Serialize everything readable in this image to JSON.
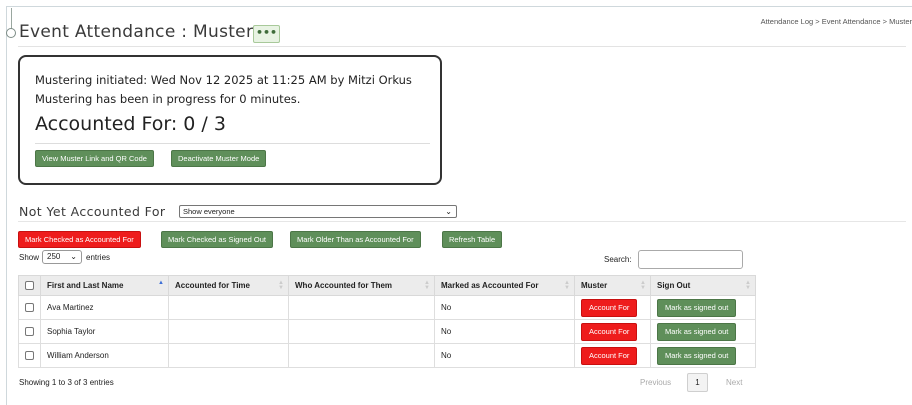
{
  "header": {
    "title": "Event Attendance : Muster",
    "more_label": "•••",
    "breadcrumb": "Attendance Log > Event Attendance > Muster"
  },
  "muster": {
    "initiated_text": "Mustering initiated: Wed Nov 12 2025 at 11:25 AM by Mitzi Orkus",
    "progress_text": "Mustering has been in progress for 0 minutes.",
    "accounted_text": "Accounted For: 0 / 3",
    "view_link_label": "View Muster Link and QR Code",
    "deactivate_label": "Deactivate Muster Mode"
  },
  "section": {
    "title": "Not Yet Accounted For",
    "filter_selected": "Show everyone"
  },
  "actions": {
    "mark_checked_accounted": "Mark Checked as Accounted For",
    "mark_checked_signed_out": "Mark Checked as Signed Out",
    "mark_older_than": "Mark Older Than as Accounted For",
    "refresh": "Refresh Table"
  },
  "table_controls": {
    "show_label": "Show",
    "page_size": "250",
    "entries_label": "entries",
    "search_label": "Search:"
  },
  "table": {
    "columns": [
      "First and Last Name",
      "Accounted for Time",
      "Who Accounted for Them",
      "Marked as Accounted For",
      "Muster",
      "Sign Out"
    ],
    "rows": [
      {
        "name": "Ava Martinez",
        "time": "",
        "who": "",
        "marked": "No",
        "muster_btn": "Account For",
        "signout_btn": "Mark as signed out"
      },
      {
        "name": "Sophia Taylor",
        "time": "",
        "who": "",
        "marked": "No",
        "muster_btn": "Account For",
        "signout_btn": "Mark as signed out"
      },
      {
        "name": "William Anderson",
        "time": "",
        "who": "",
        "marked": "No",
        "muster_btn": "Account For",
        "signout_btn": "Mark as signed out"
      }
    ]
  },
  "footer": {
    "info": "Showing 1 to 3 of 3 entries",
    "previous": "Previous",
    "page": "1",
    "next": "Next"
  },
  "colors": {
    "accent_green": "#5f8f5a",
    "danger_red": "#ee1c1c"
  }
}
